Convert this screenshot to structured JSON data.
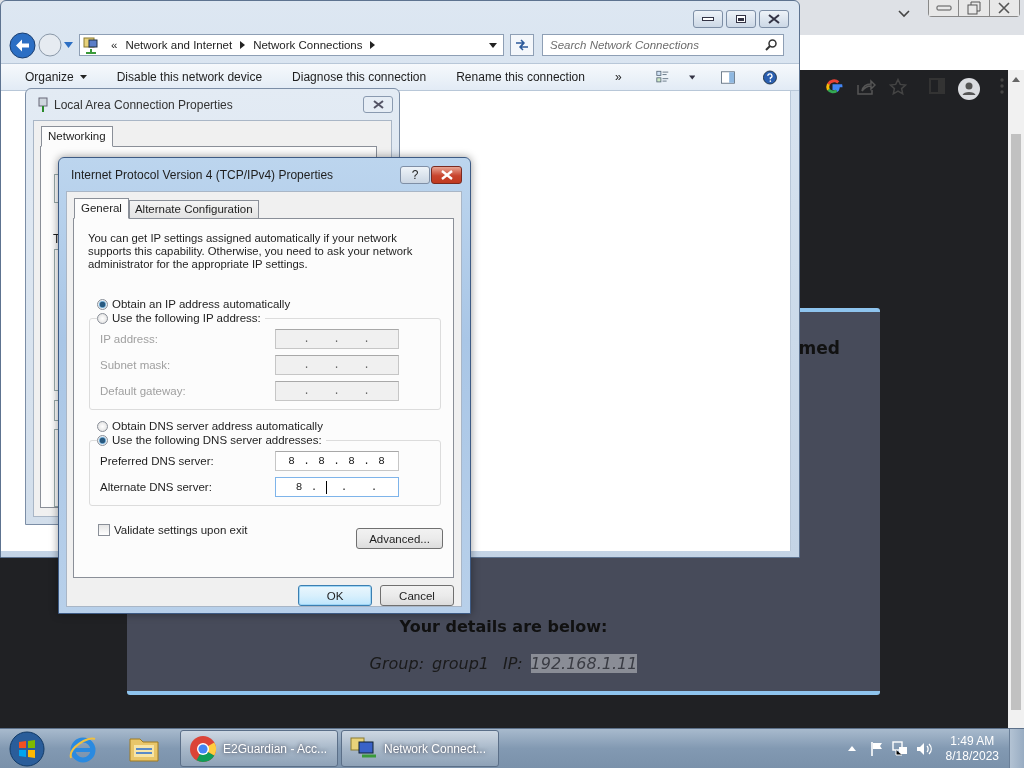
{
  "chrome": {
    "page": {
      "heading": "med",
      "details_heading": "Your details are below:",
      "details": [
        {
          "label": "Group:",
          "value": "group1",
          "highlighted": false
        },
        {
          "label": "IP:",
          "value": "192.168.1.11",
          "highlighted": true
        }
      ]
    }
  },
  "explorer": {
    "breadcrumb_prefix": "«",
    "breadcrumb": [
      "Network and Internet",
      "Network Connections"
    ],
    "search": {
      "placeholder": "Search Network Connections"
    },
    "toolbar": [
      {
        "label": "Organize",
        "kind": "menu"
      },
      {
        "label": "Disable this network device",
        "kind": "command"
      },
      {
        "label": "Diagnose this connection",
        "kind": "command"
      },
      {
        "label": "Rename this connection",
        "kind": "command"
      },
      {
        "label": "»",
        "kind": "overflow"
      }
    ]
  },
  "lan_dialog": {
    "title": "Local Area Connection Properties",
    "tabs": [
      {
        "label": "Networking",
        "selected": true
      }
    ],
    "labels": [
      "T"
    ]
  },
  "ipv4_dialog": {
    "title": "Internet Protocol Version 4 (TCP/IPv4) Properties",
    "help_label": "?",
    "tabs": [
      {
        "label": "General",
        "selected": true
      },
      {
        "label": "Alternate Configuration",
        "selected": false
      }
    ],
    "intro": "You can get IP settings assigned automatically if your network supports this capability. Otherwise, you need to ask your network administrator for the appropriate IP settings.",
    "ip_options": [
      {
        "label": "Obtain an IP address automatically",
        "selected": true
      },
      {
        "label": "Use the following IP address:",
        "selected": false
      }
    ],
    "ip_fields": [
      {
        "label": "IP address:",
        "value": ".   .   .",
        "disabled": true,
        "focused": false
      },
      {
        "label": "Subnet mask:",
        "value": ".   .   .",
        "disabled": true,
        "focused": false
      },
      {
        "label": "Default gateway:",
        "value": ".   .   .",
        "disabled": true,
        "focused": false
      }
    ],
    "dns_options": [
      {
        "label": "Obtain DNS server address automatically",
        "selected": false
      },
      {
        "label": "Use the following DNS server addresses:",
        "selected": true
      }
    ],
    "dns_fields": [
      {
        "label": "Preferred DNS server:",
        "value": "8 . 8 . 8 . 8",
        "disabled": false,
        "focused": false
      },
      {
        "label": "Alternate DNS server:",
        "value": "8 .   .   .",
        "disabled": false,
        "focused": true
      }
    ],
    "validate": {
      "label": "Validate settings upon exit",
      "checked": false
    },
    "advanced_button": "Advanced...",
    "buttons": [
      {
        "label": "OK",
        "default": true
      },
      {
        "label": "Cancel",
        "default": false
      }
    ]
  },
  "taskbar": {
    "tasks": [
      {
        "label": "E2Guardian - Acc...",
        "kind": "browser"
      },
      {
        "label": "Network Connect...",
        "kind": "network"
      }
    ],
    "time": "1:49 AM",
    "date": "8/18/2023"
  }
}
